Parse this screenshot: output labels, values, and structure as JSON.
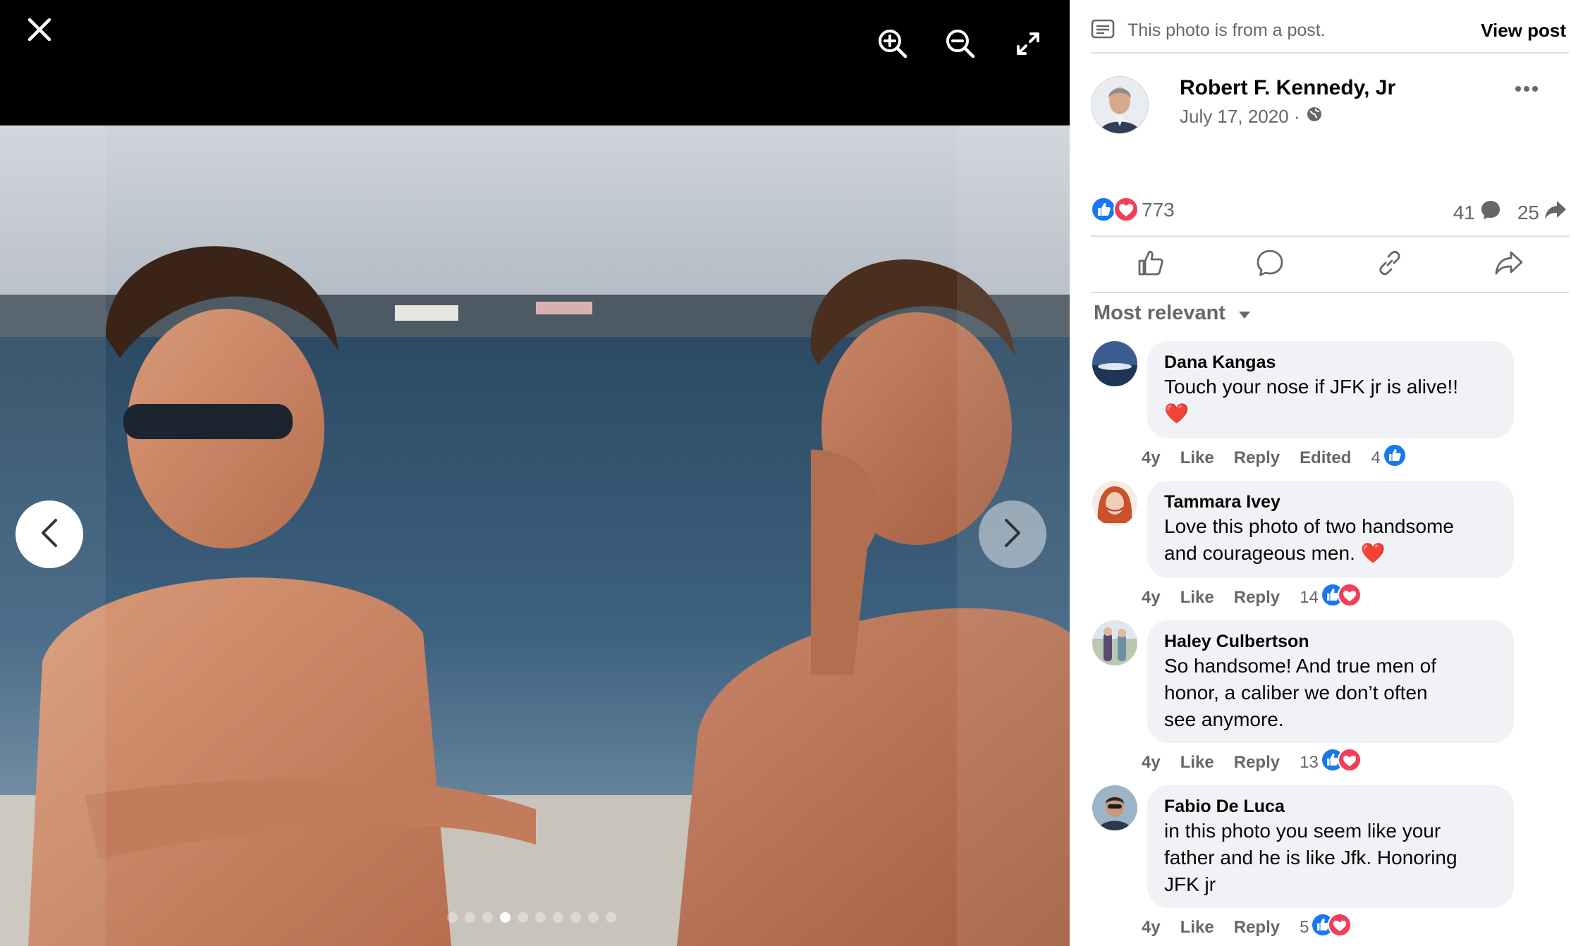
{
  "viewer": {
    "icons": {
      "close": "close-icon",
      "zoom_in": "zoom-in-icon",
      "zoom_out": "zoom-out-icon",
      "fullscreen": "fullscreen-icon",
      "prev": "chevron-left-icon",
      "next": "chevron-right-icon"
    },
    "pager": {
      "total": 10,
      "current": 4
    }
  },
  "panel": {
    "source_text": "This photo is from a post.",
    "view_post": "View post",
    "author": {
      "name": "Robert F. Kennedy, Jr",
      "date": "July 17, 2020 ·",
      "visibility_icon": "globe-icon"
    },
    "stats": {
      "reactions": "773",
      "comments": "41",
      "shares": "25"
    },
    "sort_label": "Most relevant",
    "colors": {
      "like_blue": "#1877f2",
      "love_red": "#f33e58",
      "muted": "#65676b",
      "bubble": "#f0f2f5"
    }
  },
  "comments": [
    {
      "name": "Dana Kangas",
      "lines": [
        "Touch your nose if JFK jr is alive!!",
        "❤️"
      ],
      "time": "4y",
      "like": "Like",
      "reply": "Reply",
      "edited": "Edited",
      "count": "4"
    },
    {
      "name": "Tammara Ivey",
      "lines": [
        "Love this photo of two handsome",
        "and courageous men. ❤️"
      ],
      "time": "4y",
      "like": "Like",
      "reply": "Reply",
      "count": "14"
    },
    {
      "name": "Haley Culbertson",
      "lines": [
        "So handsome! And true men of",
        "honor, a caliber we don’t often",
        "see anymore."
      ],
      "time": "4y",
      "like": "Like",
      "reply": "Reply",
      "count": "13"
    },
    {
      "name": "Fabio De Luca",
      "lines": [
        "in this photo you seem like your",
        "father and he is like Jfk. Honoring",
        "JFK jr"
      ],
      "time": "4y",
      "like": "Like",
      "reply": "Reply",
      "count": "5"
    }
  ]
}
